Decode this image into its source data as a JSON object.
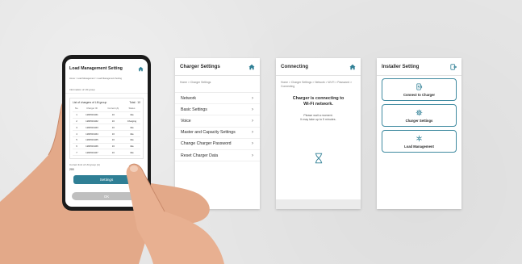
{
  "phone_screen": {
    "title": "Load Management Setting",
    "breadcrumb": "Home > Load Management > Load Management Setting",
    "info_label": "Information of LM group",
    "list_title": "List of chargers of LM group",
    "total_label": "Total : 10",
    "columns": [
      "No.",
      "Charger ID",
      "Current (A)",
      "Status"
    ],
    "rows": [
      [
        "1",
        "1282519461",
        "16",
        "Idle"
      ],
      [
        "2",
        "1282519462",
        "16",
        "Charging"
      ],
      [
        "3",
        "1282519463",
        "16",
        "Idle"
      ],
      [
        "4",
        "1282519464",
        "16",
        "Idle"
      ],
      [
        "5",
        "1282519465",
        "16",
        "Idle"
      ],
      [
        "6",
        "1282519466",
        "16",
        "Idle"
      ],
      [
        "7",
        "1282519467",
        "16",
        "Idle"
      ]
    ],
    "capacity_label": "Current limit of LM group (A)",
    "capacity_value": "200",
    "settings_button": "Settings",
    "ok_button": "OK"
  },
  "charger_settings": {
    "title": "Charger Settings",
    "breadcrumb": "Home > Charger Settings",
    "items": [
      {
        "label": "Network"
      },
      {
        "label": "Basic Settings"
      },
      {
        "label": "Voice"
      },
      {
        "label": "Master and Capacity Settings"
      },
      {
        "label": "Change Charger Password"
      },
      {
        "label": "Reset Charger Data"
      }
    ]
  },
  "connecting": {
    "title": "Connecting",
    "breadcrumb": "Home > Charger Settings > Network > Wi-Fi > Password > Connecting",
    "heading_line1": "Charger is connecting to",
    "heading_line2": "Wi-Fi network.",
    "wait_line1": "Please wait a moment.",
    "wait_line2": "It may take up to 5 minutes."
  },
  "installer": {
    "title": "Installer Setting",
    "cards": [
      {
        "label": "Connect to Charger",
        "icon": "charger-icon"
      },
      {
        "label": "Charger Settings",
        "icon": "gear-icon"
      },
      {
        "label": "Load Management",
        "icon": "load-icon"
      }
    ]
  },
  "colors": {
    "accent": "#2f7f95",
    "background": "#e6e6e6",
    "header_text": "#2a2a2a"
  }
}
